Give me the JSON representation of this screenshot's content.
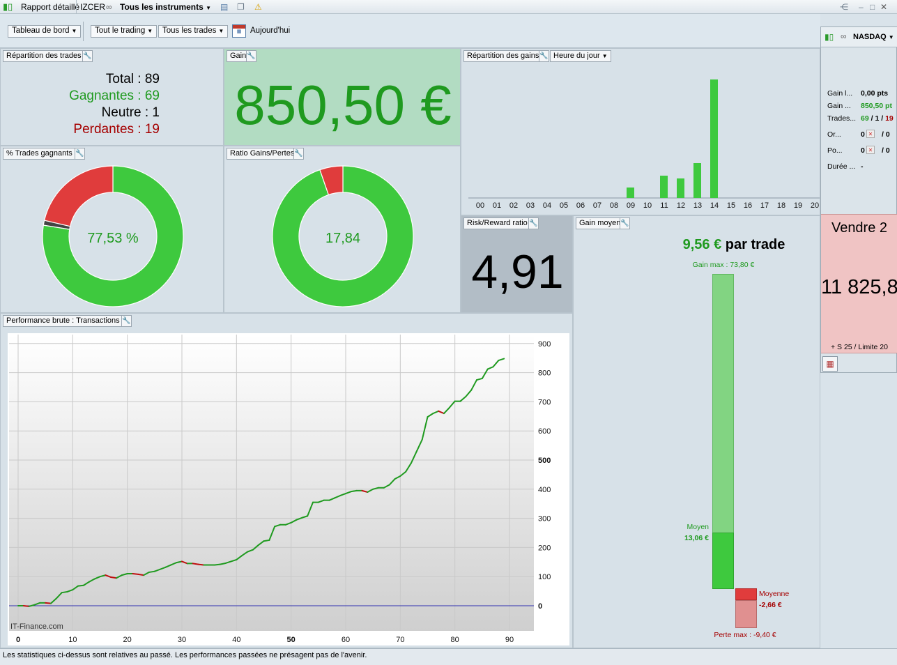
{
  "titlebar": {
    "report_tab": "Rapport détaillé",
    "account": "IZCER",
    "instruments": "Tous les instruments"
  },
  "toolbar": {
    "dashboard": "Tableau de bord",
    "trading": "Tout le trading",
    "trades": "Tous les trades",
    "today": "Aujourd'hui"
  },
  "trades_panel": {
    "title": "Répartition des trades",
    "total": "Total : 89",
    "winners": "Gagnantes : 69",
    "neutral": "Neutre : 1",
    "losers": "Perdantes : 19"
  },
  "gain_panel": {
    "title": "Gain",
    "value": "850,50 €"
  },
  "win_pct_panel": {
    "title": "% Trades gagnants",
    "value": "77,53 %",
    "win_fraction": 0.7753,
    "neutral_fraction": 0.0112,
    "loss_fraction": 0.2135
  },
  "ratio_panel": {
    "title": "Ratio Gains/Pertes",
    "value": "17,84",
    "win_fraction": 0.9469,
    "loss_fraction": 0.0531
  },
  "gains_dist_panel": {
    "title": "Répartition des gains",
    "selector": "Heure du jour"
  },
  "rr_panel": {
    "title": "Risk/Reward ratio",
    "value": "4,91"
  },
  "avg_gain_panel": {
    "title": "Gain moyen",
    "headline_value": "9,56 €",
    "headline_suffix": "par trade",
    "gain_max": "Gain max : 73,80 €",
    "avg_win_label": "Moyen",
    "avg_win_value": "13,06 €",
    "avg_loss_label": "Moyenne",
    "avg_loss_value": "-2,66 €",
    "loss_max": "Perte max : -9,40 €"
  },
  "perf_panel": {
    "title": "Performance brute : Transactions",
    "watermark": "IT-Finance.com"
  },
  "side": {
    "instrument": "NASDAQ",
    "rows": [
      {
        "label": "Gain l...",
        "value": "0,00 pts"
      },
      {
        "label": "Gain ...",
        "value": "850,50 pt"
      },
      {
        "label": "Trades...",
        "value": "69 / 1 / 19"
      },
      {
        "label": "Or...",
        "value": "0"
      },
      {
        "label": "Po...",
        "value": "0"
      },
      {
        "label": "Durée ...",
        "value": "-"
      }
    ],
    "or_value2": "/ 0",
    "po_value2": "/ 0",
    "sell_title": "Vendre 2",
    "sell_price": "11 825,8",
    "sell_footer": "+ S 25 / Limite 20"
  },
  "status": {
    "text": "Les statistiques ci-dessus sont relatives au passé. Les performances passées ne présagent pas de l'avenir."
  },
  "colors": {
    "win": "#3ec93e",
    "loss": "#e03c3c",
    "neutral": "#444444",
    "gain_bg": "#b2dcc2",
    "rr_bg": "#b2bdc6",
    "sell_bg": "#f0c4c4"
  },
  "chart_data": [
    {
      "type": "bar",
      "title": "Répartition des gains",
      "categories": [
        "00",
        "01",
        "02",
        "03",
        "04",
        "05",
        "06",
        "07",
        "08",
        "09",
        "10",
        "11",
        "12",
        "13",
        "14",
        "15",
        "16",
        "17",
        "18",
        "19",
        "20"
      ],
      "values": [
        0,
        0,
        0,
        0,
        0,
        0,
        0,
        0,
        0,
        15,
        0,
        32,
        28,
        50,
        170,
        0,
        0,
        0,
        0,
        0,
        0
      ],
      "xlabel": "",
      "ylabel": "",
      "grid": false
    },
    {
      "type": "line",
      "title": "Performance brute : Transactions",
      "x": [
        0,
        1,
        2,
        3,
        4,
        5,
        6,
        7,
        8,
        9,
        10,
        11,
        12,
        13,
        14,
        15,
        16,
        17,
        18,
        19,
        20,
        21,
        22,
        23,
        24,
        25,
        26,
        27,
        28,
        29,
        30,
        31,
        32,
        33,
        34,
        35,
        36,
        37,
        38,
        39,
        40,
        41,
        42,
        43,
        44,
        45,
        46,
        47,
        48,
        49,
        50,
        51,
        52,
        53,
        54,
        55,
        56,
        57,
        58,
        59,
        60,
        61,
        62,
        63,
        64,
        65,
        66,
        67,
        68,
        69,
        70,
        71,
        72,
        73,
        74,
        75,
        76,
        77,
        78,
        79,
        80,
        81,
        82,
        83,
        84,
        85,
        86,
        87,
        88,
        89
      ],
      "values": [
        0,
        0,
        -2,
        3,
        10,
        10,
        8,
        25,
        45,
        48,
        55,
        68,
        70,
        82,
        92,
        100,
        105,
        98,
        95,
        105,
        110,
        110,
        108,
        105,
        115,
        118,
        125,
        132,
        140,
        148,
        152,
        145,
        145,
        142,
        140,
        140,
        140,
        142,
        146,
        152,
        158,
        172,
        185,
        192,
        208,
        222,
        225,
        272,
        278,
        278,
        285,
        295,
        302,
        308,
        355,
        355,
        362,
        362,
        370,
        378,
        385,
        392,
        395,
        395,
        390,
        400,
        405,
        405,
        415,
        435,
        445,
        460,
        490,
        530,
        570,
        648,
        660,
        668,
        660,
        680,
        702,
        702,
        718,
        740,
        775,
        780,
        812,
        820,
        842,
        848
      ],
      "xlim": [
        0,
        95
      ],
      "ylim": [
        -80,
        920
      ],
      "x_ticks": [
        "0",
        "10",
        "20",
        "30",
        "40",
        "50",
        "60",
        "70",
        "80",
        "90"
      ],
      "y_ticks": [
        "0",
        "100",
        "200",
        "300",
        "400",
        "500",
        "600",
        "700",
        "800",
        "900"
      ],
      "grid": true
    }
  ]
}
